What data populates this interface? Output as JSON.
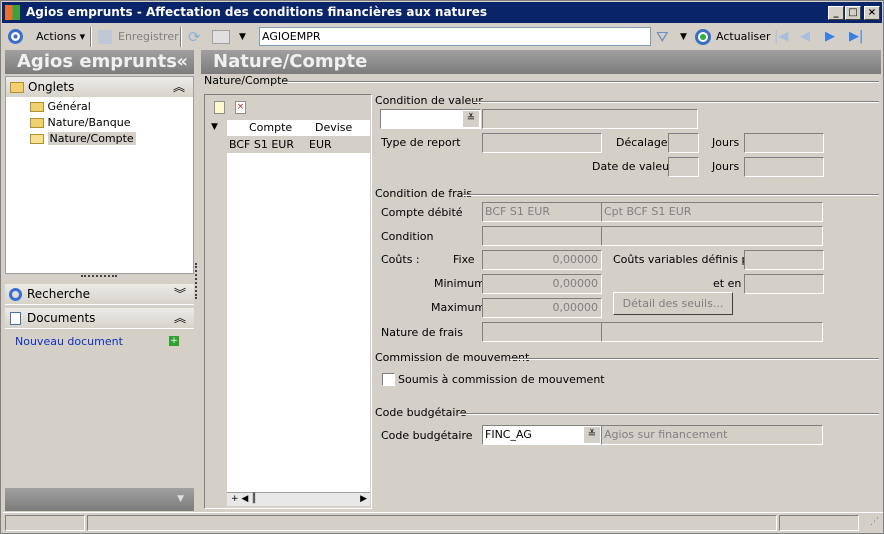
{
  "window": {
    "title": "Agios emprunts -  Affectation des conditions financières aux natures",
    "min": "_",
    "max": "□",
    "close": "×"
  },
  "toolbar": {
    "actions": "Actions",
    "save": "Enregistrer",
    "search_value": "AGIOEMPR",
    "refresh": "Actualiser"
  },
  "left": {
    "title": "Agios emprunts",
    "collapse": "«",
    "onglets": "Onglets",
    "tree": [
      "Général",
      "Nature/Banque",
      "Nature/Compte"
    ],
    "recherche": "Recherche",
    "documents": "Documents",
    "new_document": "Nouveau document"
  },
  "main": {
    "title": "Nature/Compte",
    "subtitle": "Nature/Compte",
    "list": {
      "columns": [
        "Compte",
        "Devise"
      ],
      "rows": [
        {
          "compte": "BCF S1 EUR",
          "devise": "EUR"
        }
      ]
    },
    "valeur": {
      "group": "Condition de valeur",
      "type_report": "Type de report",
      "decalage": "Décalage",
      "jours": "Jours",
      "date_valeur": "Date de valeur"
    },
    "frais": {
      "group": "Condition de frais",
      "compte_debite": "Compte débité",
      "compte_code": "BCF S1 EUR",
      "compte_libelle": "Cpt BCF S1 EUR",
      "condition": "Condition",
      "couts": "Coûts :",
      "fixe": "Fixe",
      "fixe_val": "0,00000",
      "minimum": "Minimum",
      "minimum_val": "0,00000",
      "maximum": "Maximum",
      "maximum_val": "0,00000",
      "couts_variables": "Coûts variables définis par",
      "et_en": "et en",
      "detail_seuils": "Détail des seuils...",
      "nature_frais": "Nature de frais"
    },
    "commission": {
      "group": "Commission de mouvement",
      "checkbox": "Soumis à commission de mouvement",
      "checked": false
    },
    "budget": {
      "group": "Code budgétaire",
      "label": "Code budgétaire",
      "code": "FINC_AG",
      "libelle": "Agios sur financement"
    }
  }
}
